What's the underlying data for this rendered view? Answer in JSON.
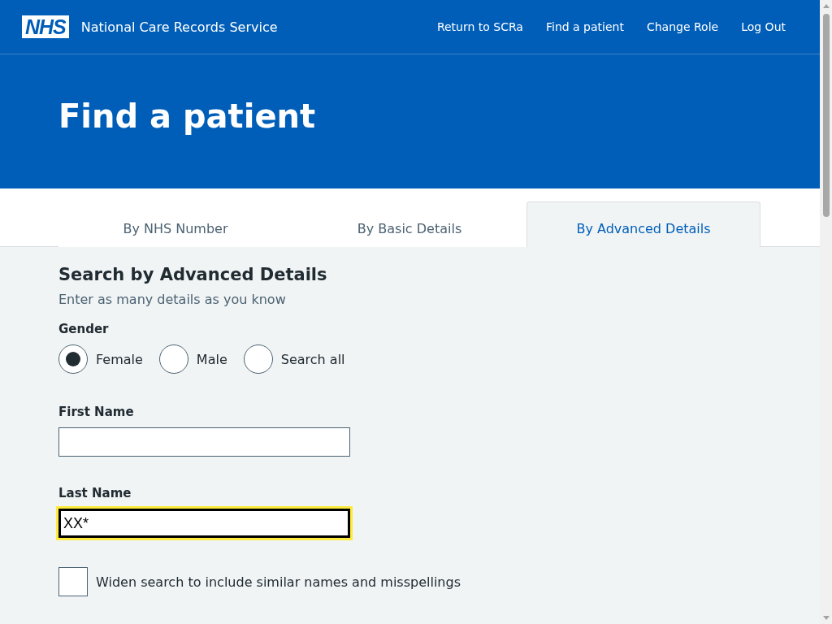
{
  "header": {
    "logo": "NHS",
    "service_name": "National Care Records Service",
    "nav": [
      {
        "label": "Return to SCRa"
      },
      {
        "label": "Find a patient"
      },
      {
        "label": "Change Role"
      },
      {
        "label": "Log Out"
      }
    ]
  },
  "hero": {
    "title": "Find a patient"
  },
  "tabs": [
    {
      "label": "By NHS Number",
      "selected": false
    },
    {
      "label": "By Basic Details",
      "selected": false
    },
    {
      "label": "By Advanced Details",
      "selected": true
    }
  ],
  "form": {
    "heading": "Search by Advanced Details",
    "hint": "Enter as many details as you know",
    "gender": {
      "label": "Gender",
      "options": [
        {
          "label": "Female",
          "selected": true
        },
        {
          "label": "Male",
          "selected": false
        },
        {
          "label": "Search all",
          "selected": false
        }
      ]
    },
    "fields": [
      {
        "label": "First Name",
        "focused": false
      },
      {
        "label": "Last Name",
        "value": "XX*",
        "focused": true
      }
    ],
    "widen_checkbox": {
      "label": "Widen search to include similar names and misspellings",
      "checked": false
    }
  }
}
